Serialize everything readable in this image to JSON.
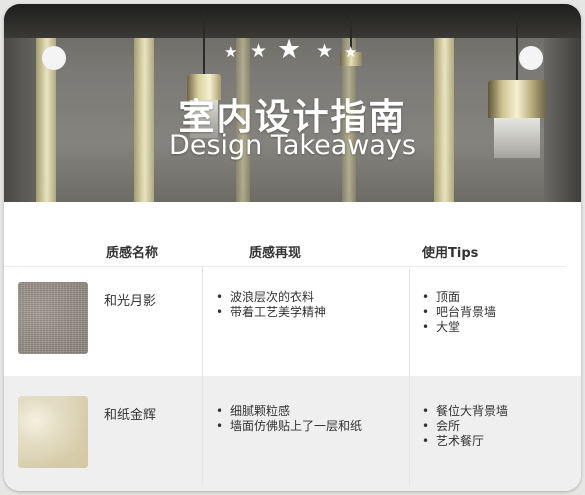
{
  "hero": {
    "stars_count": 5,
    "title": "室内设计指南",
    "subtitle": "Design Takeaways"
  },
  "table": {
    "headers": {
      "name": "质感名称",
      "effect": "质感再现",
      "tips": "使用Tips"
    },
    "rows": [
      {
        "name": "和光月影",
        "swatch": "linen-gray-texture",
        "effects": [
          "波浪层次的衣料",
          "带着工艺美学精神"
        ],
        "tips": [
          "顶面",
          "吧台背景墙",
          "大堂"
        ]
      },
      {
        "name": "和纸金辉",
        "swatch": "pale-gold-texture",
        "effects": [
          "细腻颗粒感",
          "墙面仿佛贴上了一层和纸"
        ],
        "tips": [
          "餐位大背景墙",
          "会所",
          "艺术餐厅"
        ]
      }
    ]
  },
  "colors": {
    "page_background": "#e6e6e4",
    "card_background": "#ffffff",
    "alt_row_background": "#efefef",
    "text": "#333333",
    "hero_text": "#ffffff"
  }
}
